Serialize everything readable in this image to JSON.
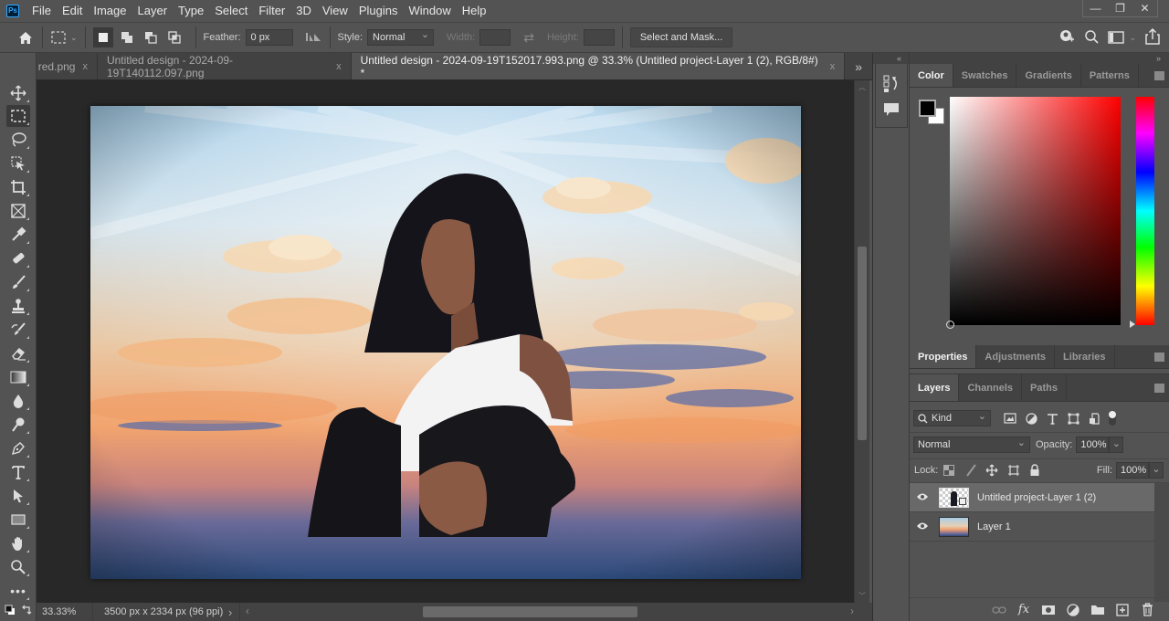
{
  "app": {
    "logo": "Ps",
    "name": "Photoshop"
  },
  "menubar": {
    "items": [
      "File",
      "Edit",
      "Image",
      "Layer",
      "Type",
      "Select",
      "Filter",
      "3D",
      "View",
      "Plugins",
      "Window",
      "Help"
    ]
  },
  "window_controls": {
    "minimize": "—",
    "restore": "❐",
    "close": "✕"
  },
  "options_bar": {
    "feather_label": "Feather:",
    "feather_value": "0 px",
    "style_label": "Style:",
    "style_value": "Normal",
    "width_label": "Width:",
    "height_label": "Height:",
    "select_and_mask": "Select and Mask..."
  },
  "tabs": [
    {
      "label": "red.png",
      "close": "x",
      "active": false
    },
    {
      "label": "Untitled design - 2024-09-19T140112.097.png",
      "close": "x",
      "active": false
    },
    {
      "label": "Untitled design - 2024-09-19T152017.993.png @ 33.3% (Untitled project-Layer 1 (2), RGB/8#) *",
      "close": "x",
      "active": true
    }
  ],
  "tabs_overflow": "»",
  "panel_collapse": {
    "left": "«",
    "right": "»",
    "toolbar": "»"
  },
  "status": {
    "zoom": "33.33%",
    "doc_info": "3500 px x 2334 px (96 ppi)",
    "arrow": "›",
    "left_arrow": "‹",
    "right_arrow": "›"
  },
  "color_panel": {
    "tabs": [
      "Color",
      "Swatches",
      "Gradients",
      "Patterns"
    ],
    "active_tab": "Color",
    "foreground": "#000000",
    "background": "#ffffff",
    "hue_color": "#ff0000"
  },
  "properties_panel": {
    "tabs": [
      "Properties",
      "Adjustments",
      "Libraries"
    ],
    "active_tab": "Properties"
  },
  "layers_panel": {
    "tabs": [
      "Layers",
      "Channels",
      "Paths"
    ],
    "active_tab": "Layers",
    "filter_kind": "Kind",
    "blend_mode": "Normal",
    "opacity_label": "Opacity:",
    "opacity_value": "100%",
    "lock_label": "Lock:",
    "fill_label": "Fill:",
    "fill_value": "100%",
    "layers": [
      {
        "name": "Untitled project-Layer 1 (2)",
        "visible": true,
        "selected": true
      },
      {
        "name": "Layer 1",
        "visible": true,
        "selected": false
      }
    ]
  }
}
